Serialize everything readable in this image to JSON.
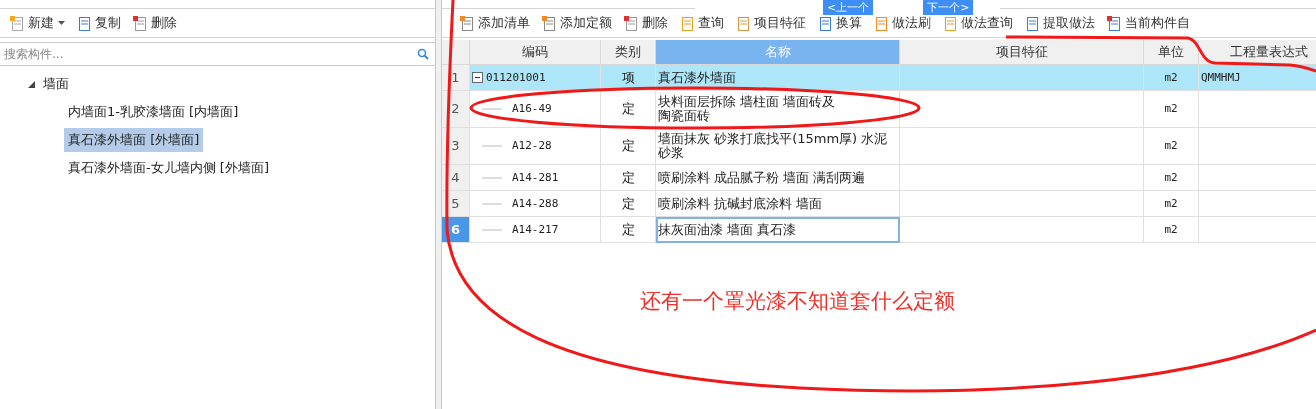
{
  "left_toolbar": [
    {
      "label": "新建",
      "dropdown": true
    },
    {
      "label": "复制",
      "dropdown": false
    },
    {
      "label": "删除",
      "dropdown": false
    }
  ],
  "search": {
    "placeholder": "搜索构件..."
  },
  "tree": [
    {
      "label": "墙面",
      "expanded": true,
      "selected": false,
      "children": [
        {
          "label": "内墙面1-乳胶漆墙面 [内墙面]",
          "selected": false
        },
        {
          "label": "真石漆外墙面 [外墙面]",
          "selected": true
        },
        {
          "label": "真石漆外墙面-女儿墙内侧 [外墙面]",
          "selected": false
        }
      ]
    }
  ],
  "toolbar": [
    {
      "label": "添加清单"
    },
    {
      "label": "添加定额"
    },
    {
      "label": "删除"
    },
    {
      "label": "查询"
    },
    {
      "label": "项目特征"
    },
    {
      "label": "换算"
    },
    {
      "label": "做法刷"
    },
    {
      "label": "做法查询"
    },
    {
      "label": "提取做法"
    },
    {
      "label": "当前构件自"
    }
  ],
  "nav_popup": {
    "prev": "<上一个",
    "next": "下一个>"
  },
  "table": {
    "columns": [
      {
        "label": "编码",
        "selected": false
      },
      {
        "label": "类别",
        "selected": false
      },
      {
        "label": "名称",
        "selected": true
      },
      {
        "label": "项目特征",
        "selected": false
      },
      {
        "label": "单位",
        "selected": false
      },
      {
        "label": "工程量表达式",
        "selected": false
      }
    ],
    "rows": [
      {
        "number": "1",
        "kind": "list",
        "expanded": true,
        "highlighted": true,
        "selected": false,
        "code": "011201001",
        "type": "项",
        "name": "真石漆外墙面",
        "unit": "m2",
        "expression": "QMMHMJ"
      },
      {
        "number": "2",
        "kind": "quota",
        "highlighted": false,
        "selected": false,
        "code": "A16-49",
        "type": "定",
        "name": "块料面层拆除 墙柱面 墙面砖及陶瓷面砖",
        "unit": "m2"
      },
      {
        "number": "3",
        "kind": "quota",
        "highlighted": false,
        "selected": false,
        "code": "A12-28",
        "type": "定",
        "name": "墙面抹灰 砂浆打底找平(15mm厚) 水泥砂浆",
        "unit": "m2"
      },
      {
        "number": "4",
        "kind": "quota",
        "highlighted": false,
        "selected": false,
        "code": "A14-281",
        "type": "定",
        "name": "喷刷涂料 成品腻子粉 墙面 满刮两遍",
        "unit": "m2"
      },
      {
        "number": "5",
        "kind": "quota",
        "highlighted": false,
        "selected": false,
        "code": "A14-288",
        "type": "定",
        "name": "喷刷涂料 抗碱封底涂料 墙面",
        "unit": "m2"
      },
      {
        "number": "6",
        "kind": "quota",
        "highlighted": false,
        "selected": true,
        "code": "A14-217",
        "type": "定",
        "name": "抹灰面油漆 墙面 真石漆",
        "unit": "m2"
      }
    ]
  },
  "annotation": {
    "note": "还有一个罩光漆不知道套什么定额"
  }
}
